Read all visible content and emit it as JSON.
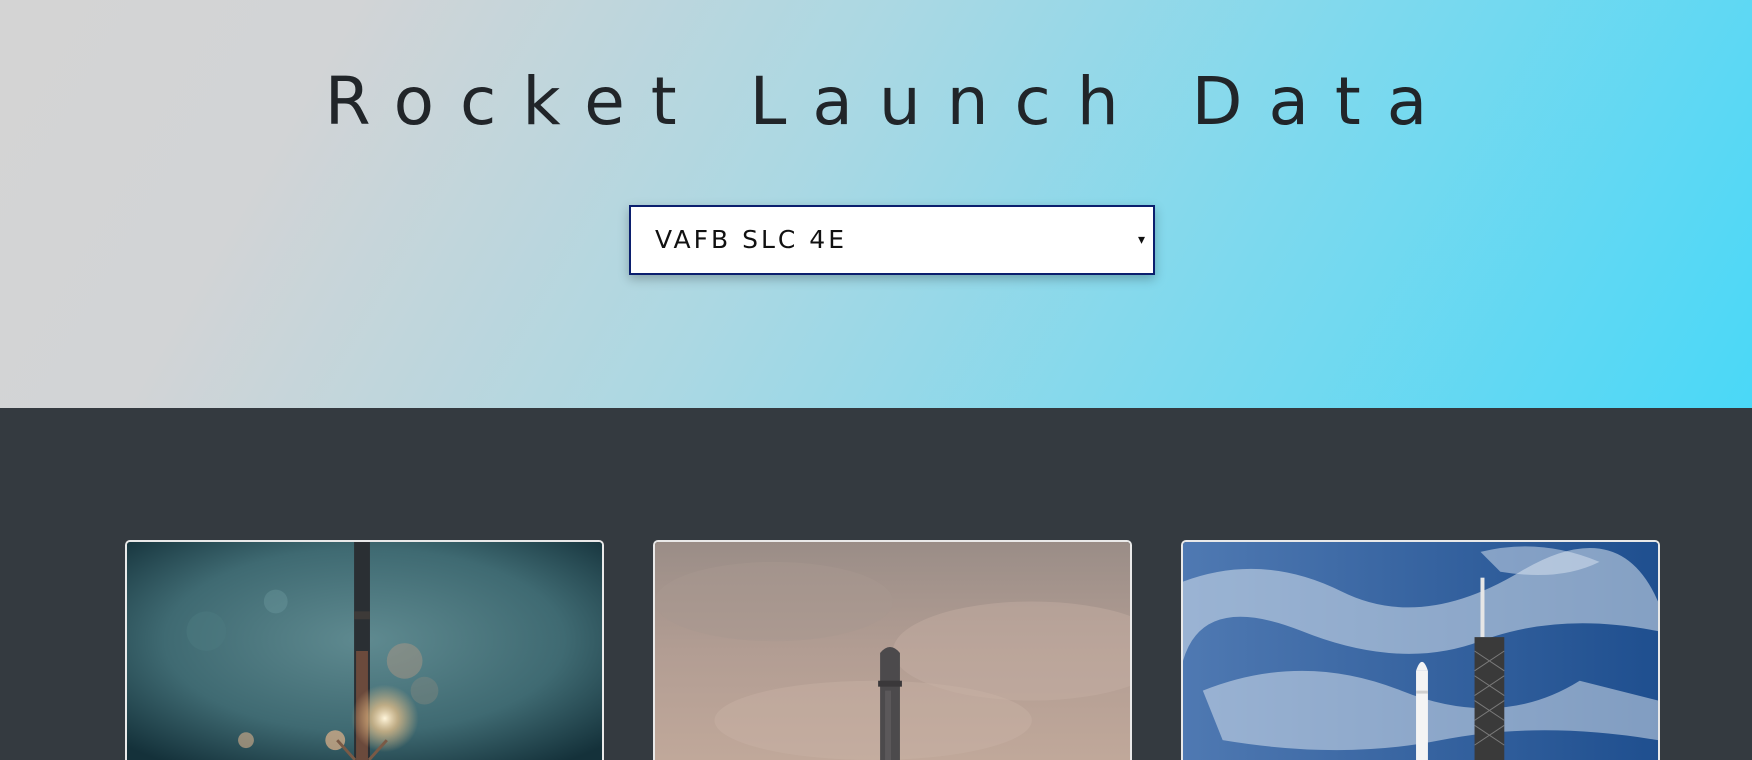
{
  "header": {
    "title": "Rocket Launch Data"
  },
  "site_select": {
    "selected": "VAFB SLC 4E",
    "caret": "▾"
  },
  "launch_cards": [
    {
      "image": "rocket-landing-night-photo"
    },
    {
      "image": "rocket-hazy-sky-photo"
    },
    {
      "image": "rocket-on-launch-tower-photo"
    }
  ],
  "colors": {
    "hero_gradient_start": "#d4d4d4",
    "hero_gradient_end": "#4ad8f7",
    "content_background": "#343a40",
    "title_text": "#212529",
    "select_border": "#0b1f6e"
  }
}
